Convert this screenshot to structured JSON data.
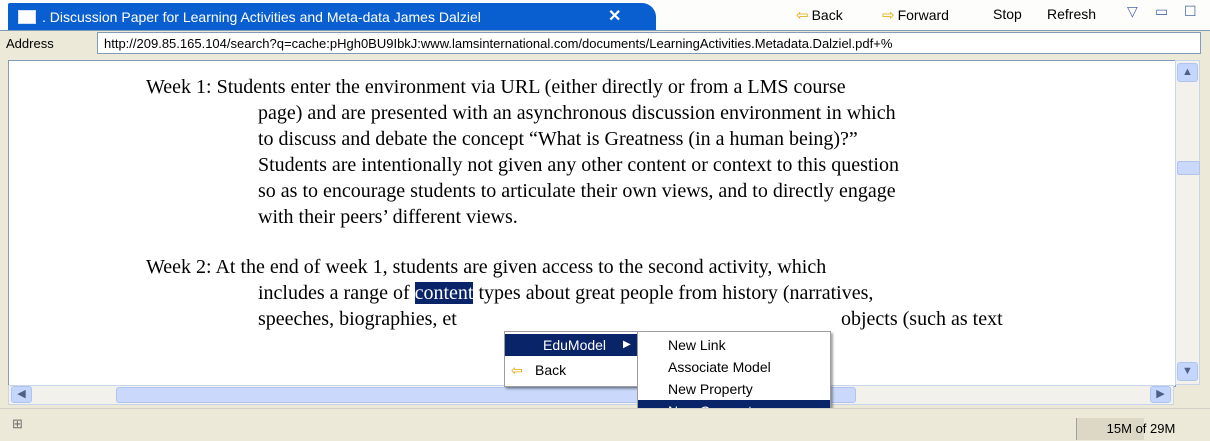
{
  "tab": {
    "title": ". Discussion Paper for Learning Activities and Meta-data James Dalziel",
    "close": "✕"
  },
  "toolbar": {
    "back": "Back",
    "forward": "Forward",
    "stop": "Stop",
    "refresh": "Refresh",
    "menu_icon": "▽",
    "minimize_icon": "▭",
    "maximize_icon": "☐"
  },
  "address": {
    "label": "Address",
    "url": "http://209.85.165.104/search?q=cache:pHgh0BU9IbkJ:www.lamsinternational.com/documents/LearningActivities.Metadata.Dalziel.pdf+%"
  },
  "document": {
    "week1_lines": [
      "Week 1: Students enter the environment via URL (either directly or from a LMS course",
      "page) and are presented with an asynchronous discussion environment in which",
      "to discuss and debate the concept “What is Greatness (in a human being)?”",
      "Students are intentionally not given any other content or context to this question",
      "so as to encourage students to articulate their own views, and to directly engage",
      "with their peers’ different views."
    ],
    "week2_line1": "Week 2: At the end of week 1, students are given access to the second activity, which",
    "week2_line2_pre": "includes a range of ",
    "week2_line2_sel": "content",
    "week2_line2_post": " types about great people from history (narratives,",
    "week2_line3_pre": "speeches, biographies, et",
    "week2_line3_post": "objects (such as text"
  },
  "context_menu": {
    "items": [
      "EduModel",
      "Back"
    ]
  },
  "submenu": {
    "items": [
      "New Link",
      "Associate Model",
      "New Property",
      "New Concept"
    ],
    "active_index": 3
  },
  "status": {
    "memory": "15M of 29M",
    "memory_used_fraction": 0.52
  },
  "colors": {
    "tab_active": "#0a5fd0",
    "selection": "#0a246a",
    "arrow": "#e6a600"
  }
}
